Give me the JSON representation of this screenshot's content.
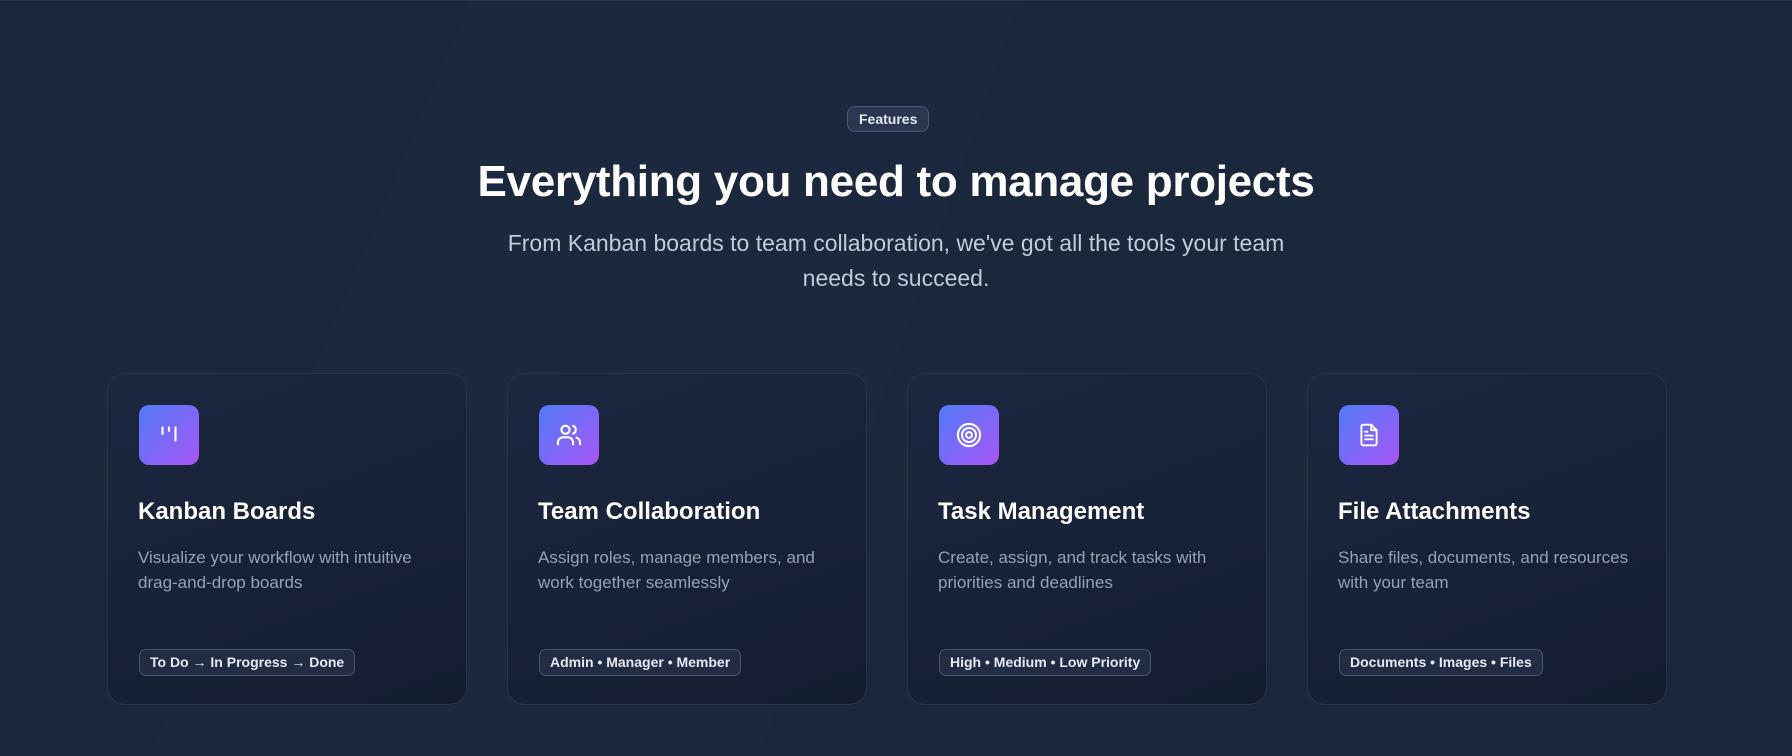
{
  "section": {
    "badge": "Features",
    "headline": "Everything you need to manage projects",
    "subtitle": "From Kanban boards to team collaboration, we've got all the tools your team needs to succeed."
  },
  "theme": {
    "background": "#1c273b",
    "card_background": "#141d30",
    "icon_gradient_start": "#4f7cf7",
    "icon_gradient_end": "#a855f7",
    "text_primary": "#ffffff",
    "text_secondary": "#97a1b4"
  },
  "features": [
    {
      "icon": "kanban-icon",
      "title": "Kanban Boards",
      "description": "Visualize your workflow with intuitive drag-and-drop boards",
      "tag": "To Do → In Progress → Done"
    },
    {
      "icon": "users-icon",
      "title": "Team Collaboration",
      "description": "Assign roles, manage members, and work together seamlessly",
      "tag": "Admin • Manager • Member"
    },
    {
      "icon": "target-icon",
      "title": "Task Management",
      "description": "Create, assign, and track tasks with priorities and deadlines",
      "tag": "High • Medium • Low Priority"
    },
    {
      "icon": "file-text-icon",
      "title": "File Attachments",
      "description": "Share files, documents, and resources with your team",
      "tag": "Documents • Images • Files"
    }
  ]
}
